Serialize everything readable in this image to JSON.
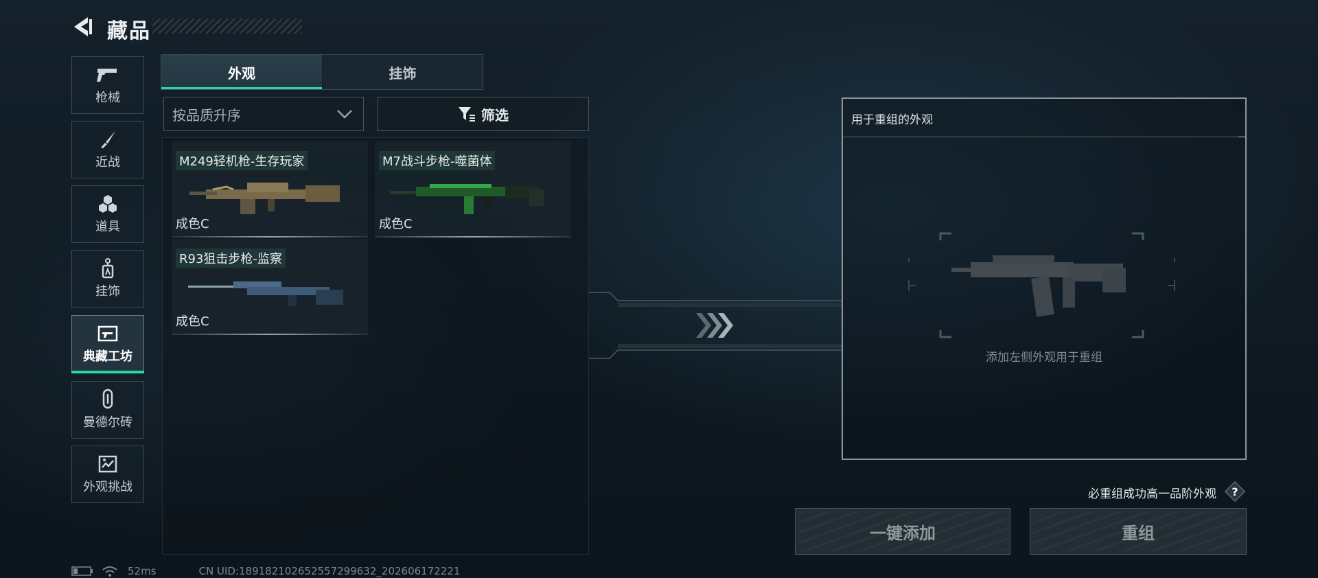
{
  "header": {
    "title": "藏品"
  },
  "sidebar": {
    "items": [
      {
        "label": "枪械",
        "icon": "pistol-icon"
      },
      {
        "label": "近战",
        "icon": "knife-icon"
      },
      {
        "label": "道具",
        "icon": "grenade-icon"
      },
      {
        "label": "挂饰",
        "icon": "charm-icon"
      },
      {
        "label": "典藏工坊",
        "icon": "workshop-icon",
        "active": true
      },
      {
        "label": "曼德尔砖",
        "icon": "brick-icon"
      },
      {
        "label": "外观挑战",
        "icon": "challenge-icon"
      }
    ]
  },
  "tabs": [
    {
      "label": "外观",
      "active": true
    },
    {
      "label": "挂饰",
      "active": false
    }
  ],
  "sort": {
    "value": "按品质升序"
  },
  "filter": {
    "label": "筛选"
  },
  "items": [
    {
      "name": "M249轻机枪-生存玩家",
      "condition": "成色C"
    },
    {
      "name": "M7战斗步枪-噬菌体",
      "condition": "成色C"
    },
    {
      "name": "R93狙击步枪-监察",
      "condition": "成色C"
    }
  ],
  "recombine": {
    "header": "用于重组的外观",
    "hint": "添加左侧外观用于重组",
    "guarantee": "必重组成功高一品阶外观",
    "add_button": "一键添加",
    "recombine_button": "重组"
  },
  "status": {
    "ping": "52ms",
    "uid": "CN UID:18918210265255729963​2_202606172221"
  },
  "colors": {
    "accent": "#2fd6a4"
  }
}
